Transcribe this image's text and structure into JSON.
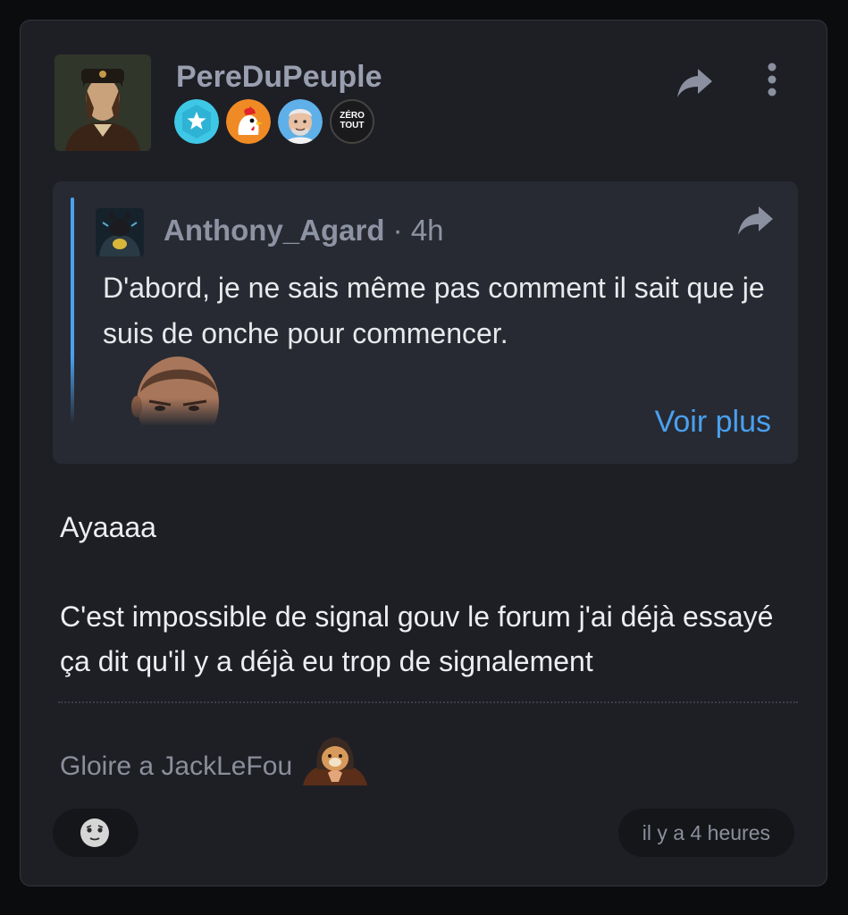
{
  "post": {
    "author": "PereDuPeuple",
    "badges": [
      {
        "name": "star-badge",
        "color": "#3ec8e6"
      },
      {
        "name": "rooster-badge",
        "color": "#f08a24"
      },
      {
        "name": "harold-badge",
        "color": "#5fb0e8"
      },
      {
        "name": "zero-tout-badge",
        "line1": "ZÉRO",
        "line2": "TOUT"
      }
    ],
    "body_paragraphs": [
      "Ayaaaa",
      "C'est impossible de signal gouv le forum j'ai déjà essayé ça dit qu'il y a déjà eu trop de signalement"
    ],
    "signature": "Gloire a JackLeFou",
    "timestamp": "il y a 4 heures"
  },
  "quote": {
    "author": "Anthony_Agard",
    "time": "4h",
    "separator": " · ",
    "text": "D'abord, je ne sais même pas comment il sait que je suis de onche pour commencer.",
    "see_more": "Voir plus"
  },
  "colors": {
    "accent": "#4aa0f0",
    "card_bg": "#1e1f25",
    "quote_bg": "#272a32",
    "page_bg": "#0b0c0e"
  },
  "icons": {
    "share": "share-arrow-icon",
    "more": "vertical-dots-icon",
    "reaction": "emoji-face-icon"
  }
}
